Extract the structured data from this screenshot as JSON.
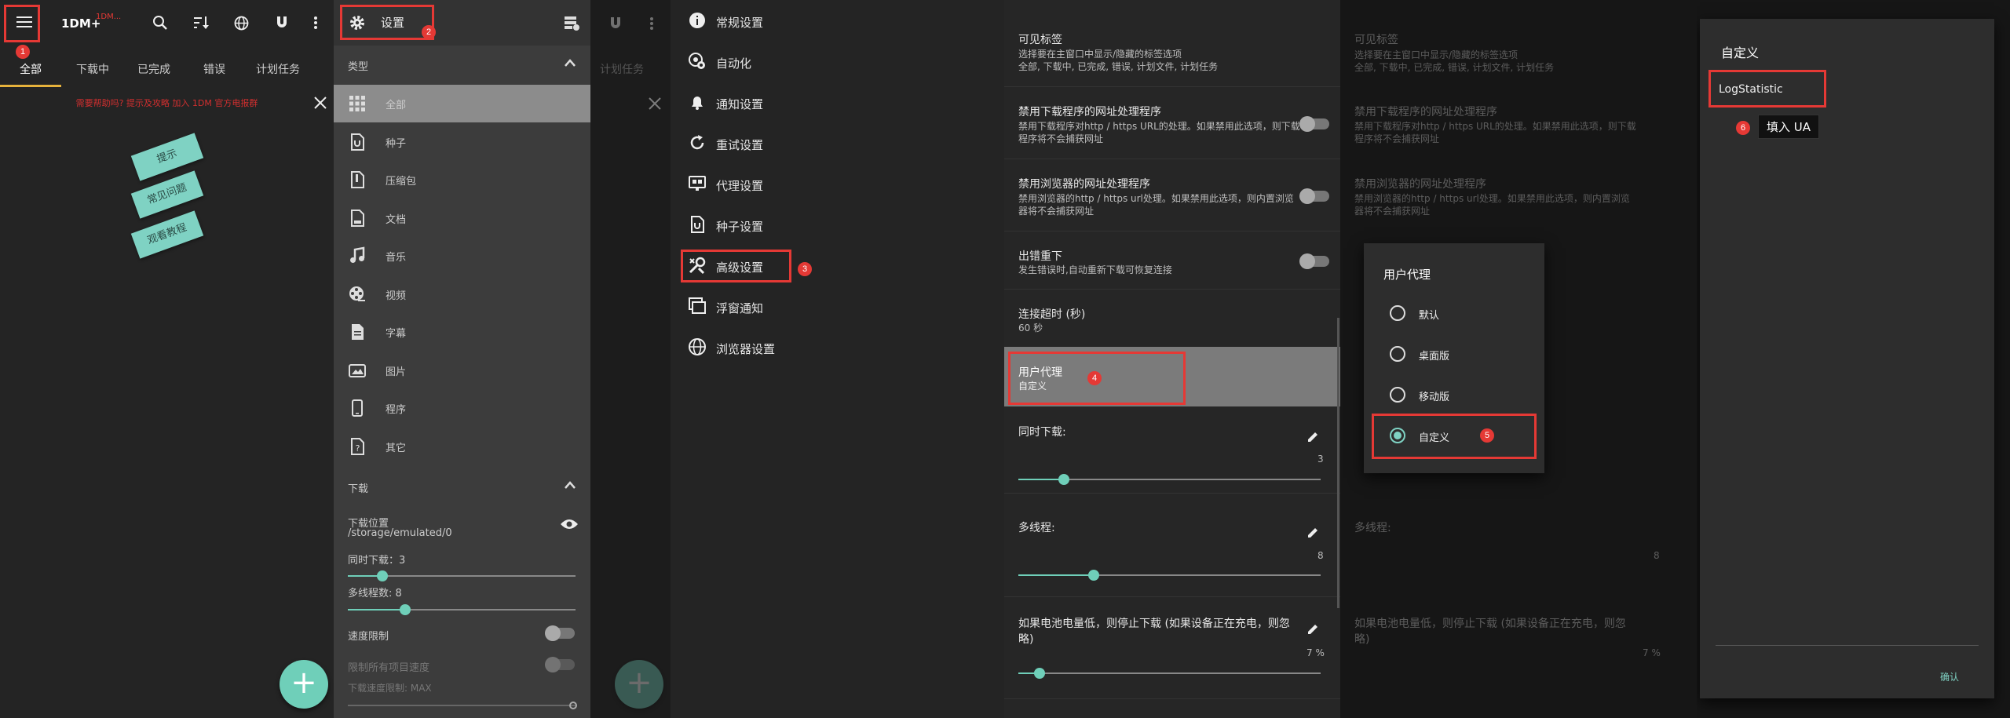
{
  "p1": {
    "app_title": "1DM+",
    "title_badge": "1DM...",
    "tabs": [
      "全部",
      "下载中",
      "已完成",
      "错误",
      "计划任务"
    ],
    "notice": "需要帮助吗? 提示及攻略 加入 1DM 官方电报群",
    "stickers": [
      "提示",
      "常见问题",
      "观看教程"
    ],
    "fab": "+",
    "step": "1"
  },
  "p2": {
    "settings_label": "设置",
    "step": "2",
    "section_type": "类型",
    "items": [
      {
        "label": "全部",
        "icon": "grid-icon"
      },
      {
        "label": "种子",
        "icon": "torrent-file-icon"
      },
      {
        "label": "压缩包",
        "icon": "archive-icon"
      },
      {
        "label": "文档",
        "icon": "document-icon"
      },
      {
        "label": "音乐",
        "icon": "music-icon"
      },
      {
        "label": "视频",
        "icon": "video-icon"
      },
      {
        "label": "字幕",
        "icon": "subtitle-icon"
      },
      {
        "label": "图片",
        "icon": "image-icon"
      },
      {
        "label": "程序",
        "icon": "phone-icon"
      },
      {
        "label": "其它",
        "icon": "unknown-file-icon"
      }
    ],
    "section_download": "下载",
    "download_location_label": "下载位置",
    "download_location": "/storage/emulated/0",
    "concurrent": "同时下载：3",
    "threads": "多线程数: 8",
    "speed_limit": "速度限制",
    "limit_all": "限制所有项目速度",
    "speed_max": "下载速度限制: MAX",
    "concurrent_value": 3,
    "threads_value": 8
  },
  "p3": {
    "fab": "+"
  },
  "p4": {
    "items": [
      {
        "label": "常规设置",
        "icon": "info-icon"
      },
      {
        "label": "自动化",
        "icon": "automation-icon"
      },
      {
        "label": "通知设置",
        "icon": "bell-icon"
      },
      {
        "label": "重试设置",
        "icon": "retry-icon"
      },
      {
        "label": "代理设置",
        "icon": "proxy-icon"
      },
      {
        "label": "种子设置",
        "icon": "torrent-file-icon"
      },
      {
        "label": "高级设置",
        "icon": "wrench-icon"
      },
      {
        "label": "浮窗通知",
        "icon": "window-icon"
      },
      {
        "label": "浏览器设置",
        "icon": "globe-icon"
      }
    ],
    "step": "3"
  },
  "p5": {
    "visible_tabs_title": "可见标签",
    "visible_tabs_sub1": "选择要在主窗口中显示/隐藏的标签选项",
    "visible_tabs_sub2": "全部, 下载中, 已完成, 错误, 计划文件, 计划任务",
    "disable_handler_title": "禁用下载程序的网址处理程序",
    "disable_handler_sub": "禁用下载程序对http / https URL的处理。如果禁用此选项，则下载程序将不会捕获网址",
    "disable_browser_title": "禁用浏览器的网址处理程序",
    "disable_browser_sub": "禁用浏览器的http / https url处理。如果禁用此选项，则内置浏览器将不会捕获网址",
    "retry_title": "出错重下",
    "retry_sub": "发生错误时,自动重新下载可恢复连接",
    "timeout_title": "连接超时 (秒)",
    "timeout_sub": "60 秒",
    "ua_title": "用户代理",
    "ua_sub": "自定义",
    "step": "4",
    "concurrent_title": "同时下载:",
    "concurrent_value": "3",
    "threads_title": "多线程:",
    "threads_value": "8",
    "battery_title": "如果电池电量低，则停止下载 (如果设备正在充电，则忽略)",
    "battery_value": "7 %",
    "concurrent_level": 3,
    "threads_level": 8,
    "battery_level": 7
  },
  "p6": {
    "dialog_title": "用户代理",
    "options": [
      "默认",
      "桌面版",
      "移动版",
      "自定义"
    ],
    "selected": 3,
    "step": "5"
  },
  "p7": {
    "dialog_title": "自定义",
    "input_value": "LogStatistic",
    "tooltip": "填入 UA",
    "confirm": "确认",
    "step": "6"
  }
}
